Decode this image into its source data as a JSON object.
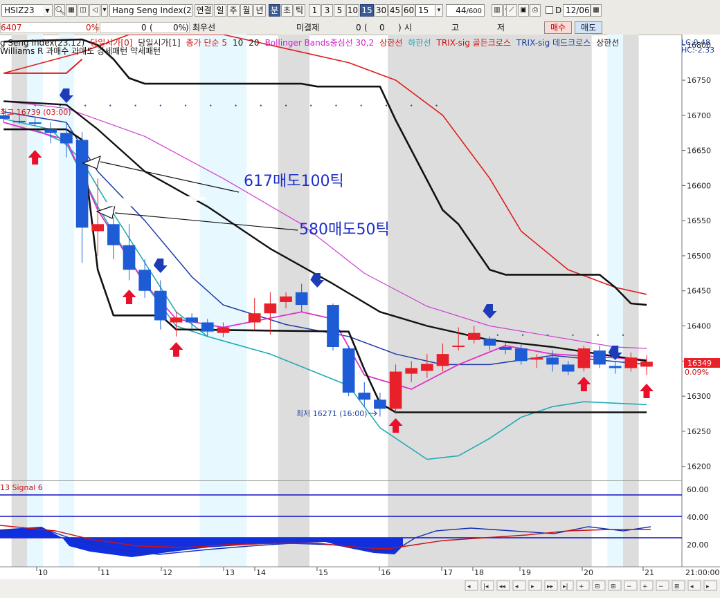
{
  "toolbar": {
    "symbol": "HSIZ23",
    "instrument": "Hang Seng Index(23.1",
    "period_buttons": [
      "연결",
      "일",
      "주",
      "월",
      "년"
    ],
    "interval_buttons": [
      "분",
      "초",
      "틱"
    ],
    "minute_buttons": [
      "1",
      "3",
      "5",
      "10",
      "15",
      "30",
      "45",
      "60"
    ],
    "selected_minute": "15",
    "interval_value": "15",
    "count": "44",
    "count_max": "/600",
    "d_label": "D",
    "date": "12/06"
  },
  "info_bar": {
    "price": "6407",
    "change_pct": "0%",
    "qty": "0",
    "paren_open": "(",
    "paren_value": "0%",
    "paren_close": ")",
    "best_label": "최우선",
    "open_interest_label": "미결제",
    "oi_value": "0",
    "oi_paren_open": "(",
    "oi_paren_value": "0",
    "oi_paren_close": ")",
    "ohlc_labels": [
      "시",
      "고",
      "저"
    ],
    "buy_button": "매수",
    "sell_button": "매도"
  },
  "legend": {
    "items": [
      {
        "text": "g Seng Index(23.12)",
        "color": "#1a1a1a"
      },
      {
        "text": "당일시가[0]",
        "color": "#cc1111"
      },
      {
        "text": "당일시가[1]",
        "color": "#1a1a1a"
      },
      {
        "text": "종가 단순 5",
        "color": "#cc1111"
      },
      {
        "text": "10",
        "color": "#1a1a1a"
      },
      {
        "text": "20",
        "color": "#1a1a1a"
      },
      {
        "text": "Bollinger Bands중심선 30,2",
        "color": "#cc22cc"
      },
      {
        "text": "상한선",
        "color": "#cc1111"
      },
      {
        "text": "하한선",
        "color": "#22a8b0"
      },
      {
        "text": "TRIX-sig 골든크로스",
        "color": "#cc1111"
      },
      {
        "text": "TRIX-sig 데드크로스",
        "color": "#1a3fa0"
      },
      {
        "text": "상한선",
        "color": "#1a1a1a"
      }
    ],
    "line2": "Williams R 과매수 과매도 강세패턴  약세패턴",
    "lc": "LC:0.48",
    "hc": "HC:-2.33"
  },
  "annotations": {
    "high_label": "최고 16739 (03:00)",
    "low_label": "최저 16271 (16:00)",
    "note1": "617매도100틱",
    "note2": "580매도50틱",
    "price_badge": "16349",
    "price_badge_pct": "0.09%"
  },
  "sub_panel": {
    "title": "13  Signal 6",
    "ticks": [
      "60.00",
      "40.00",
      "20.00"
    ]
  },
  "x_axis": {
    "labels": [
      "10",
      "11",
      "12",
      "13",
      "14",
      "15",
      "16",
      "17",
      "18",
      "19",
      "20",
      "21"
    ],
    "end_time": "21:00:00"
  },
  "colors": {
    "up": "#e8202a",
    "down": "#1e5cd6",
    "arrow_up": "#e8102a",
    "arrow_down": "#1c3cb8",
    "shade": "#dddddd",
    "light": "#e8f8ff",
    "bb_upper": "#e01b1b",
    "bb_lower": "#22aab5",
    "bb_mid": "#d23ad2",
    "ma_blue": "#1f3aa8"
  },
  "chart_data": {
    "type": "candlestick",
    "y_axis_ticks": [
      16800,
      16750,
      16700,
      16650,
      16600,
      16550,
      16500,
      16450,
      16400,
      16350,
      16300,
      16250,
      16200
    ],
    "ylim": [
      16180,
      16815
    ],
    "candles": [
      {
        "i": 0,
        "o": 16700,
        "h": 16710,
        "l": 16690,
        "c": 16695
      },
      {
        "i": 1,
        "o": 16692,
        "h": 16700,
        "l": 16688,
        "c": 16690
      },
      {
        "i": 2,
        "o": 16690,
        "h": 16696,
        "l": 16685,
        "c": 16688
      },
      {
        "i": 3,
        "o": 16680,
        "h": 16690,
        "l": 16660,
        "c": 16675
      },
      {
        "i": 4,
        "o": 16675,
        "h": 16690,
        "l": 16640,
        "c": 16660
      },
      {
        "i": 5,
        "o": 16665,
        "h": 16676,
        "l": 16490,
        "c": 16540
      },
      {
        "i": 6,
        "o": 16535,
        "h": 16610,
        "l": 16500,
        "c": 16545
      },
      {
        "i": 7,
        "o": 16545,
        "h": 16555,
        "l": 16495,
        "c": 16515
      },
      {
        "i": 8,
        "o": 16515,
        "h": 16545,
        "l": 16465,
        "c": 16480
      },
      {
        "i": 9,
        "o": 16480,
        "h": 16495,
        "l": 16440,
        "c": 16450
      },
      {
        "i": 10,
        "o": 16450,
        "h": 16465,
        "l": 16395,
        "c": 16408
      },
      {
        "i": 11,
        "o": 16405,
        "h": 16420,
        "l": 16385,
        "c": 16412
      },
      {
        "i": 12,
        "o": 16412,
        "h": 16418,
        "l": 16395,
        "c": 16405
      },
      {
        "i": 13,
        "o": 16405,
        "h": 16410,
        "l": 16385,
        "c": 16392
      },
      {
        "i": 14,
        "o": 16390,
        "h": 16405,
        "l": 16384,
        "c": 16398
      },
      {
        "i": 16,
        "o": 16405,
        "h": 16440,
        "l": 16395,
        "c": 16418
      },
      {
        "i": 17,
        "o": 16418,
        "h": 16448,
        "l": 16388,
        "c": 16432
      },
      {
        "i": 18,
        "o": 16434,
        "h": 16448,
        "l": 16425,
        "c": 16442
      },
      {
        "i": 19,
        "o": 16448,
        "h": 16460,
        "l": 16420,
        "c": 16430
      },
      {
        "i": 21,
        "o": 16430,
        "h": 16432,
        "l": 16365,
        "c": 16370
      },
      {
        "i": 22,
        "o": 16368,
        "h": 16372,
        "l": 16300,
        "c": 16305
      },
      {
        "i": 23,
        "o": 16305,
        "h": 16320,
        "l": 16285,
        "c": 16295
      },
      {
        "i": 24,
        "o": 16295,
        "h": 16305,
        "l": 16271,
        "c": 16282
      },
      {
        "i": 25,
        "o": 16282,
        "h": 16345,
        "l": 16275,
        "c": 16335
      },
      {
        "i": 26,
        "o": 16332,
        "h": 16350,
        "l": 16320,
        "c": 16340
      },
      {
        "i": 27,
        "o": 16336,
        "h": 16360,
        "l": 16326,
        "c": 16346
      },
      {
        "i": 28,
        "o": 16343,
        "h": 16375,
        "l": 16335,
        "c": 16360
      },
      {
        "i": 29,
        "o": 16370,
        "h": 16398,
        "l": 16365,
        "c": 16372
      },
      {
        "i": 30,
        "o": 16380,
        "h": 16400,
        "l": 16375,
        "c": 16390
      },
      {
        "i": 31,
        "o": 16382,
        "h": 16385,
        "l": 16365,
        "c": 16372
      },
      {
        "i": 32,
        "o": 16370,
        "h": 16377,
        "l": 16360,
        "c": 16366
      },
      {
        "i": 33,
        "o": 16368,
        "h": 16375,
        "l": 16345,
        "c": 16350
      },
      {
        "i": 34,
        "o": 16352,
        "h": 16360,
        "l": 16340,
        "c": 16355
      },
      {
        "i": 35,
        "o": 16355,
        "h": 16365,
        "l": 16335,
        "c": 16345
      },
      {
        "i": 36,
        "o": 16345,
        "h": 16350,
        "l": 16330,
        "c": 16335
      },
      {
        "i": 37,
        "o": 16340,
        "h": 16372,
        "l": 16335,
        "c": 16368
      },
      {
        "i": 38,
        "o": 16365,
        "h": 16372,
        "l": 16340,
        "c": 16345
      },
      {
        "i": 39,
        "o": 16343,
        "h": 16350,
        "l": 16332,
        "c": 16340
      },
      {
        "i": 40,
        "o": 16340,
        "h": 16362,
        "l": 16335,
        "c": 16355
      },
      {
        "i": 41,
        "o": 16342,
        "h": 16358,
        "l": 16330,
        "c": 16349
      }
    ],
    "bb_upper": [
      [
        0,
        16760
      ],
      [
        5,
        16790
      ],
      [
        8,
        16815
      ],
      [
        14,
        16815
      ],
      [
        22,
        16775
      ],
      [
        25,
        16750
      ],
      [
        28,
        16700
      ],
      [
        31,
        16610
      ],
      [
        33,
        16535
      ],
      [
        36,
        16480
      ],
      [
        39,
        16455
      ],
      [
        41,
        16445
      ]
    ],
    "bb_lower": [
      [
        0,
        16695
      ],
      [
        3,
        16680
      ],
      [
        5,
        16635
      ],
      [
        7,
        16560
      ],
      [
        9,
        16490
      ],
      [
        11,
        16420
      ],
      [
        13,
        16385
      ],
      [
        17,
        16360
      ],
      [
        22,
        16315
      ],
      [
        24,
        16255
      ],
      [
        27,
        16210
      ],
      [
        29,
        16215
      ],
      [
        31,
        16240
      ],
      [
        33,
        16270
      ],
      [
        35,
        16285
      ],
      [
        37,
        16292
      ],
      [
        41,
        16288
      ]
    ],
    "bb_mid": [
      [
        0,
        16720
      ],
      [
        4,
        16710
      ],
      [
        9,
        16670
      ],
      [
        14,
        16610
      ],
      [
        19,
        16545
      ],
      [
        23,
        16475
      ],
      [
        27,
        16428
      ],
      [
        31,
        16400
      ],
      [
        35,
        16385
      ],
      [
        39,
        16370
      ],
      [
        41,
        16368
      ]
    ],
    "ma_blue": [
      [
        0,
        16705
      ],
      [
        4,
        16690
      ],
      [
        6,
        16620
      ],
      [
        9,
        16550
      ],
      [
        12,
        16470
      ],
      [
        14,
        16430
      ],
      [
        18,
        16402
      ],
      [
        22,
        16385
      ],
      [
        25,
        16360
      ],
      [
        28,
        16345
      ],
      [
        31,
        16345
      ],
      [
        35,
        16358
      ],
      [
        41,
        16345
      ]
    ],
    "ma_pink": [
      [
        0,
        16690
      ],
      [
        4,
        16665
      ],
      [
        6,
        16565
      ],
      [
        9,
        16460
      ],
      [
        11,
        16410
      ],
      [
        14,
        16398
      ],
      [
        19,
        16420
      ],
      [
        21,
        16410
      ],
      [
        23,
        16330
      ],
      [
        26,
        16310
      ],
      [
        29,
        16345
      ],
      [
        32,
        16372
      ],
      [
        35,
        16360
      ],
      [
        41,
        16352
      ]
    ],
    "ma_teal": [
      [
        2,
        16680
      ],
      [
        4,
        16660
      ],
      [
        6,
        16570
      ],
      [
        9,
        16460
      ],
      [
        11,
        16400
      ],
      [
        13,
        16385
      ]
    ],
    "channel_upper": [
      [
        0,
        16805
      ],
      [
        5,
        16808
      ],
      [
        6,
        16800
      ],
      [
        7,
        16780
      ],
      [
        8,
        16753
      ],
      [
        9,
        16745
      ],
      [
        19,
        16745
      ],
      [
        20,
        16741
      ],
      [
        24,
        16741
      ],
      [
        25,
        16693
      ],
      [
        28,
        16565
      ],
      [
        29,
        16545
      ],
      [
        31,
        16480
      ],
      [
        32,
        16473
      ],
      [
        38,
        16473
      ],
      [
        39,
        16455
      ],
      [
        40,
        16432
      ],
      [
        41,
        16430
      ]
    ],
    "channel_mid": [
      [
        0,
        16720
      ],
      [
        4,
        16715
      ],
      [
        6,
        16680
      ],
      [
        9,
        16620
      ],
      [
        13,
        16570
      ],
      [
        17,
        16510
      ],
      [
        21,
        16460
      ],
      [
        24,
        16420
      ],
      [
        27,
        16400
      ],
      [
        31,
        16380
      ],
      [
        35,
        16370
      ],
      [
        41,
        16350
      ]
    ],
    "channel_lower": [
      [
        0,
        16680
      ],
      [
        4,
        16680
      ],
      [
        5,
        16665
      ],
      [
        6,
        16480
      ],
      [
        7,
        16415
      ],
      [
        10,
        16415
      ],
      [
        11,
        16395
      ],
      [
        22,
        16392
      ],
      [
        23,
        16338
      ],
      [
        24,
        16290
      ],
      [
        25,
        16277
      ],
      [
        41,
        16277
      ]
    ],
    "red_step": [
      [
        0,
        16760
      ],
      [
        4,
        16760
      ],
      [
        5,
        16780
      ]
    ],
    "arrows_up": [
      2,
      8,
      11,
      25,
      37,
      41
    ],
    "arrows_down": [
      4,
      10,
      20,
      31,
      39
    ],
    "shaded_ranges": [
      [
        1,
        2
      ],
      [
        18,
        20
      ],
      [
        25,
        38
      ],
      [
        40,
        41
      ]
    ],
    "light_ranges": [
      [
        2,
        3
      ],
      [
        4,
        5
      ],
      [
        13,
        16
      ],
      [
        39,
        40
      ]
    ]
  }
}
